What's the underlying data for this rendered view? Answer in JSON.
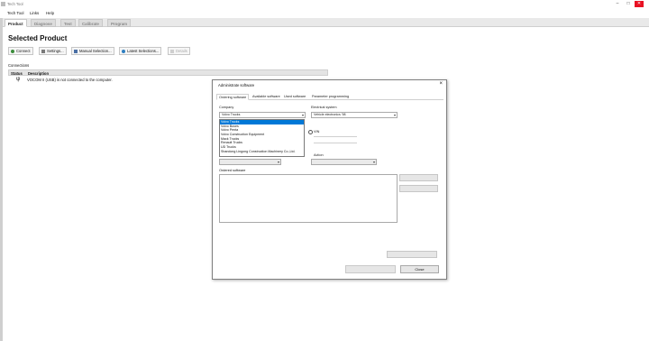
{
  "window": {
    "title": "Tech Tool"
  },
  "menu": [
    "Tech Tool",
    "Links",
    "Help"
  ],
  "tabs": [
    "Product",
    "Diagnose",
    "Test",
    "Calibrate",
    "Program"
  ],
  "page_title": "Selected Product",
  "toolbar": {
    "connect": "Connect",
    "settings": "Settings...",
    "manual_selection": "Manual Selection...",
    "latest_selections": "Latest Selections...",
    "details": "Details"
  },
  "connection": {
    "label": "Connections",
    "col_status": "Status",
    "col_description": "Description",
    "row_message": "VOCOM II (USB) is not connected to the computer."
  },
  "dialog": {
    "title": "Administrate software",
    "tabs": [
      "Ordering software",
      "Available software",
      "Used software",
      "Parameter programming"
    ],
    "company_label": "Company",
    "company_value": "Volvo Trucks",
    "company_options": [
      "Volvo Trucks",
      "Volvo Buses",
      "Volvo Penta",
      "Volvo Construction Equipment",
      "Mack Trucks",
      "Renault Trucks",
      "UD Trucks",
      "Shandong Lingong Construction Machinery Co.,Ltd."
    ],
    "selected_index": 0,
    "electrical_label": "Electrical system",
    "electrical_value": "Vehicle electronics '98",
    "radio_label": "VIN",
    "action_label": "Action",
    "ordered_label": "Ordered software",
    "close_label": "Close"
  }
}
